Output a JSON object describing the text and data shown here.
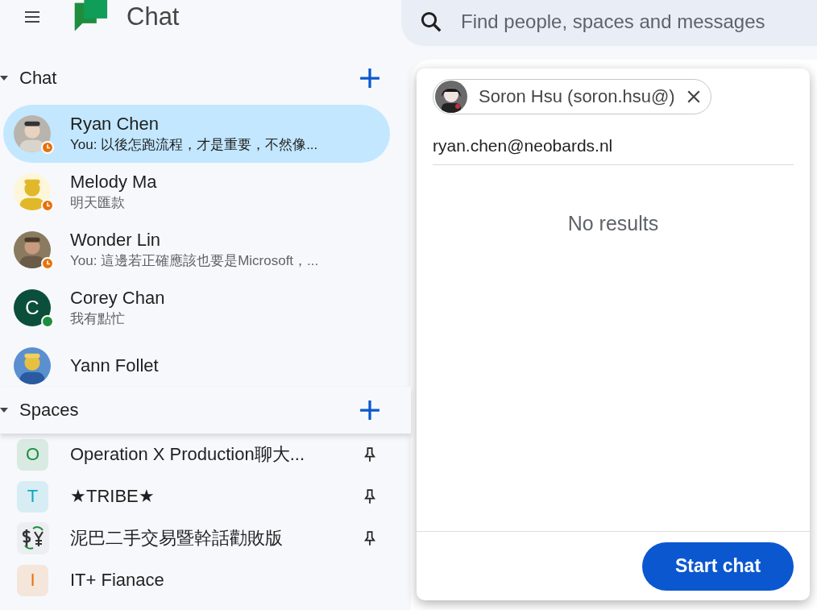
{
  "header": {
    "title": "Chat",
    "search": {
      "placeholder": "Find people, spaces and messages"
    }
  },
  "chat_section": {
    "title": "Chat",
    "expanded": true,
    "items": [
      {
        "name": "Ryan Chen",
        "preview": "You: 以後怎跑流程，才是重要，不然像...",
        "selected": true,
        "kind": "picture",
        "away": true
      },
      {
        "name": "Melody Ma",
        "preview": "明天匯款",
        "selected": false,
        "kind": "picture",
        "away": true
      },
      {
        "name": "Wonder Lin",
        "preview": "You: 這邊若正確應該也要是Microsoft，...",
        "selected": false,
        "kind": "picture",
        "away": true
      },
      {
        "name": "Corey Chan",
        "preview": "我有點忙",
        "selected": false,
        "kind": "letter",
        "letter": "C",
        "away": false
      },
      {
        "name": "Yann Follet",
        "selected": false,
        "kind": "picture"
      }
    ]
  },
  "spaces_section": {
    "title": "Spaces",
    "expanded": true,
    "items": [
      {
        "name": "Operation X Production聊大...",
        "kind": "letter",
        "letter": "O",
        "color": "#1e8e3e",
        "pinned": true
      },
      {
        "name": "★TRIBE★",
        "kind": "letter",
        "letter": "T",
        "color": "#12a4c4",
        "pinned": true
      },
      {
        "name": "泥巴二手交易暨幹話勸敗版",
        "kind": "icon",
        "pinned": true
      },
      {
        "name": "IT+ Fianace",
        "kind": "letter",
        "letter": "I",
        "color": "#e8710a",
        "pinned": false
      }
    ]
  },
  "dialog": {
    "chip": {
      "label": "Soron Hsu (soron.hsu@)"
    },
    "input": {
      "value": "ryan.chen@neobards.nl"
    },
    "message": "No results",
    "button": "Start chat"
  }
}
